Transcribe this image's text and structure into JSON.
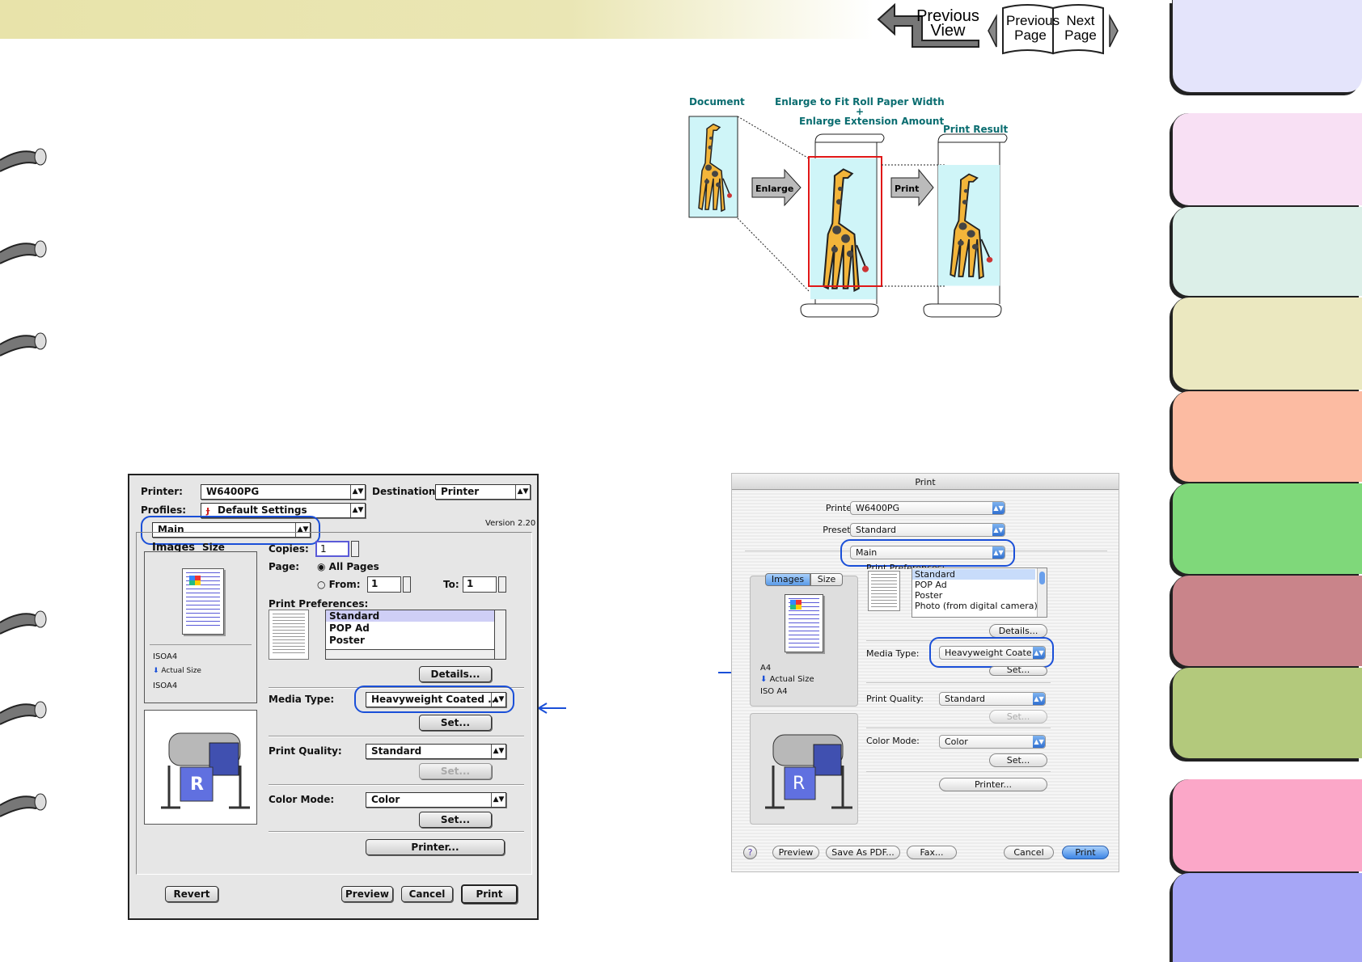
{
  "nav": {
    "prev_view": "Previous\nView",
    "prev_page": "Previous\nPage",
    "next_page": "Next\nPage"
  },
  "diagram": {
    "document_label": "Document",
    "enlarge_title_line1": "Enlarge to Fit Roll Paper Width",
    "enlarge_title_plus": "+",
    "enlarge_title_line2": "Enlarge Extension Amount",
    "result_label": "Print Result",
    "enlarge_arrow": "Enlarge",
    "print_arrow": "Print"
  },
  "os9": {
    "printer_label": "Printer:",
    "printer_value": "W6400PG",
    "destination_label": "Destination:",
    "destination_value": "Printer",
    "profiles_label": "Profiles:",
    "profiles_value": "Default Settings",
    "panel_value": "Main",
    "version": "Version 2.20",
    "tab_images": "Images",
    "tab_size": "Size",
    "copies_label": "Copies:",
    "copies_value": "1",
    "page_label": "Page:",
    "all_pages": "All Pages",
    "from_label": "From:",
    "from_value": "1",
    "to_label": "To:",
    "to_value": "1",
    "prefs_label": "Print Preferences:",
    "prefs": [
      "Standard",
      "POP Ad",
      "Poster"
    ],
    "size1": "ISOA4",
    "actual": "Actual Size",
    "size2": "ISOA4",
    "details": "Details...",
    "media_label": "Media Type:",
    "media_value": "Heavyweight Coated ...",
    "set": "Set...",
    "quality_label": "Print Quality:",
    "quality_value": "Standard",
    "color_label": "Color Mode:",
    "color_value": "Color",
    "printer_btn": "Printer...",
    "revert": "Revert",
    "preview": "Preview",
    "cancel": "Cancel",
    "print": "Print"
  },
  "osx": {
    "title": "Print",
    "printer_label": "Printer:",
    "printer_value": "W6400PG",
    "presets_label": "Presets:",
    "presets_value": "Standard",
    "panel_value": "Main",
    "tab_images": "Images",
    "tab_size": "Size",
    "prefs_label": "Print Preferences:",
    "prefs": [
      "Standard",
      "POP Ad",
      "Poster",
      "Photo (from digital camera)"
    ],
    "size1": "A4",
    "actual": "Actual Size",
    "size2": "ISO A4",
    "details": "Details...",
    "media_label": "Media Type:",
    "media_value": "Heavyweight Coate...",
    "set": "Set...",
    "quality_label": "Print Quality:",
    "quality_value": "Standard",
    "color_label": "Color Mode:",
    "color_value": "Color",
    "printer_btn": "Printer...",
    "help": "?",
    "preview": "Preview",
    "save_pdf": "Save As PDF...",
    "fax": "Fax...",
    "cancel": "Cancel",
    "print": "Print"
  },
  "colors": {
    "highlight": "#1a4fd8",
    "tabs": [
      "#e4e4fb",
      "#f8e0f4",
      "#dcefe8",
      "#ebe8c0",
      "#fcbba2",
      "#7fd87a",
      "#c9848a",
      "#b3c97c",
      "#fba7c8",
      "#a6a6f6"
    ]
  }
}
